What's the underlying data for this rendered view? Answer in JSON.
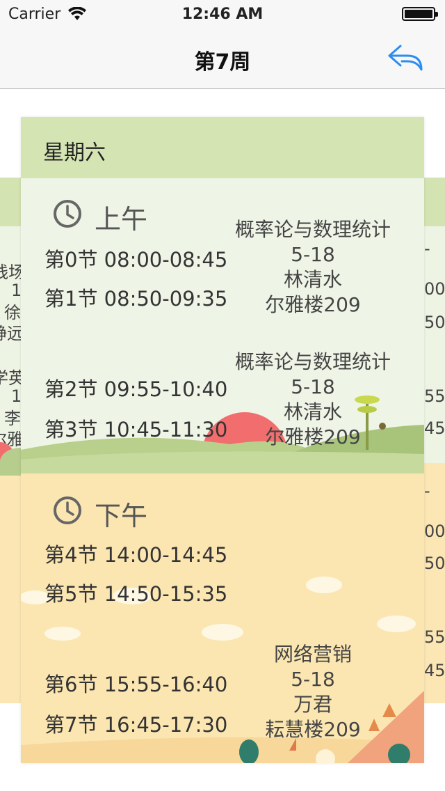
{
  "status_bar": {
    "carrier": "Carrier",
    "time": "12:46 AM"
  },
  "nav": {
    "title": "第7周",
    "back_icon": "reply-arrow-icon",
    "accent": "#2d8cf0"
  },
  "side_fragments": {
    "left": [
      "践场",
      "1",
      "徐",
      "静远",
      "学英",
      "1",
      "李",
      "尔雅"
    ],
    "right": [
      "-",
      "00-",
      "50-",
      "55-",
      "45-",
      "-",
      "00-",
      "50-",
      "55-",
      "45-"
    ]
  },
  "day_card": {
    "day": "星期六",
    "morning": {
      "label": "上午",
      "periods": [
        {
          "name": "第0节",
          "time": "08:00-08:45"
        },
        {
          "name": "第1节",
          "time": "08:50-09:35"
        },
        {
          "name": "第2节",
          "time": "09:55-10:40"
        },
        {
          "name": "第3节",
          "time": "10:45-11:30"
        }
      ],
      "courses": [
        {
          "name": "概率论与数理统计",
          "weeks": "5-18",
          "teacher": "林清水",
          "room": "尔雅楼209"
        },
        {
          "name": "概率论与数理统计",
          "weeks": "5-18",
          "teacher": "林清水",
          "room": "尔雅楼209"
        }
      ]
    },
    "afternoon": {
      "label": "下午",
      "periods": [
        {
          "name": "第4节",
          "time": "14:00-14:45"
        },
        {
          "name": "第5节",
          "time": "14:50-15:35"
        },
        {
          "name": "第6节",
          "time": "15:55-16:40"
        },
        {
          "name": "第7节",
          "time": "16:45-17:30"
        }
      ],
      "courses": [
        {
          "name": "网络营销",
          "weeks": "5-18",
          "teacher": "万君",
          "room": "耘慧楼209"
        }
      ]
    }
  },
  "colors": {
    "header_green": "#d5e4b3",
    "morning_bg": "#eef4e6",
    "afternoon_bg": "#fbe6b1",
    "sun": "#f26d6d"
  }
}
